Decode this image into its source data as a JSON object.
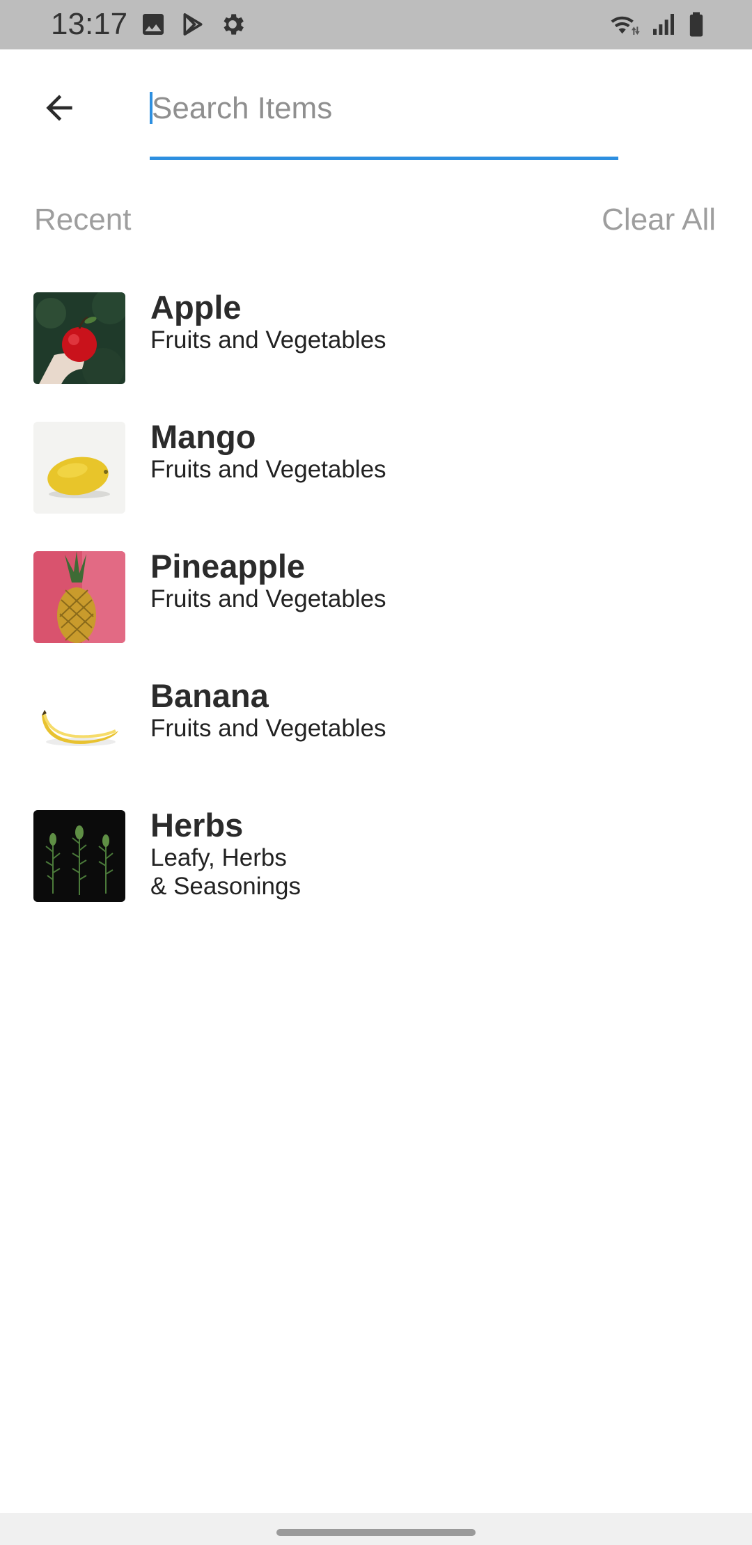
{
  "status_bar": {
    "time": "13:17",
    "icons_left": [
      "image-icon",
      "play-store-icon",
      "settings-gear-icon"
    ],
    "icons_right": [
      "wifi-icon",
      "cell-signal-icon",
      "battery-icon"
    ]
  },
  "search": {
    "value": "",
    "placeholder": "Search Items",
    "underline_color": "#2d8fe0"
  },
  "recent": {
    "label": "Recent",
    "clear_label": "Clear All"
  },
  "items": [
    {
      "title": "Apple",
      "subtitle": "Fruits and Vegetables",
      "image": "apple-photo"
    },
    {
      "title": "Mango",
      "subtitle": "Fruits and Vegetables",
      "image": "mango-photo"
    },
    {
      "title": "Pineapple",
      "subtitle": "Fruits and Vegetables",
      "image": "pineapple-photo"
    },
    {
      "title": "Banana",
      "subtitle": "Fruits and Vegetables",
      "image": "banana-photo"
    },
    {
      "title": "Herbs",
      "subtitle": "Leafy, Herbs\n& Seasonings",
      "image": "herbs-photo"
    }
  ]
}
